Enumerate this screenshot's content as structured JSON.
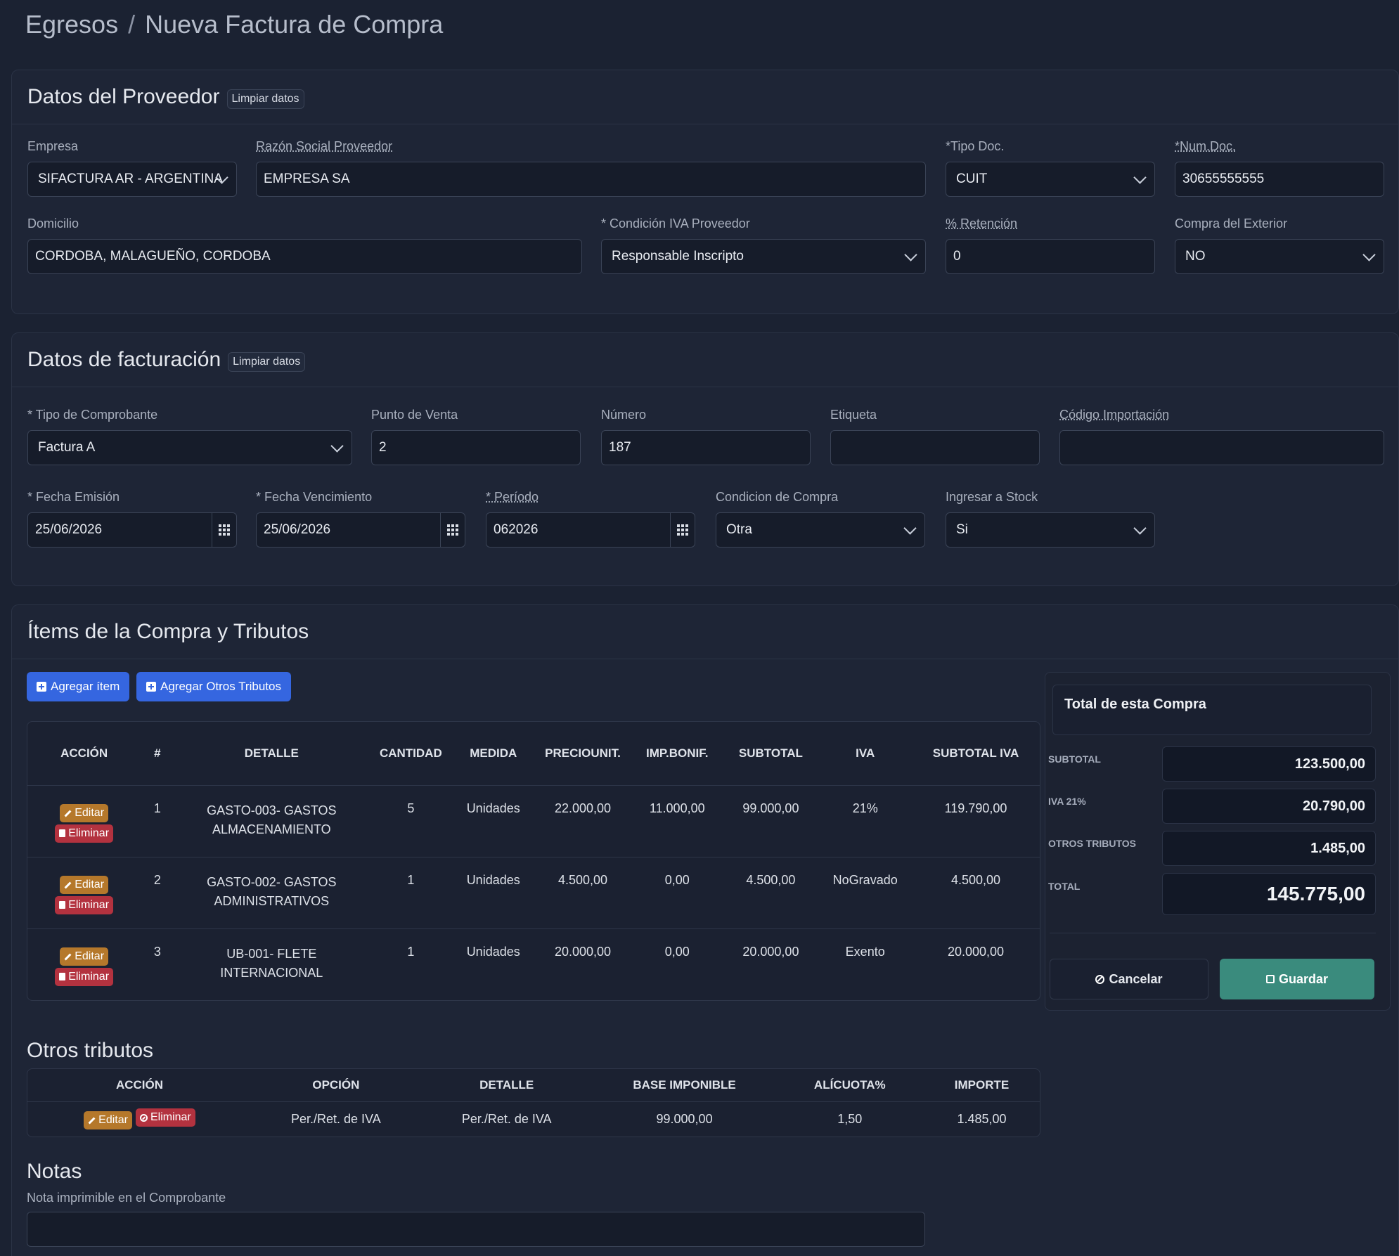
{
  "breadcrumb": {
    "parent": "Egresos",
    "separator": "/",
    "current": "Nueva Factura de Compra"
  },
  "proveedor": {
    "title": "Datos del Proveedor",
    "clear_label": "Limpiar datos",
    "empresa": {
      "label": "Empresa",
      "value": "SIFACTURA AR - ARGENTINA"
    },
    "razon_social": {
      "label": "Razón Social Proveedor",
      "value": "EMPRESA SA"
    },
    "tipo_doc": {
      "label": "*Tipo Doc.",
      "value": "CUIT"
    },
    "num_doc": {
      "label": "*Num.Doc.",
      "value": "30655555555"
    },
    "domicilio": {
      "label": "Domicilio",
      "value": "CORDOBA, MALAGUEÑO, CORDOBA"
    },
    "condicion_iva": {
      "label": "* Condición IVA Proveedor",
      "value": "Responsable Inscripto"
    },
    "retencion": {
      "label": "% Retención",
      "value": "0"
    },
    "compra_exterior": {
      "label": "Compra del Exterior",
      "value": "NO"
    }
  },
  "facturacion": {
    "title": "Datos de facturación",
    "clear_label": "Limpiar datos",
    "tipo_comprobante": {
      "label": "* Tipo de Comprobante",
      "value": "Factura A"
    },
    "punto_venta": {
      "label": "Punto de Venta",
      "value": "2"
    },
    "numero": {
      "label": "Número",
      "value": "187"
    },
    "etiqueta": {
      "label": "Etiqueta",
      "value": ""
    },
    "codigo_importacion": {
      "label": "Código Importación",
      "value": ""
    },
    "fecha_emision": {
      "label": "* Fecha Emisión",
      "value": "25/06/2026"
    },
    "fecha_vencimiento": {
      "label": "* Fecha Vencimiento",
      "value": "25/06/2026"
    },
    "periodo": {
      "label": "* Período",
      "value": "062026"
    },
    "condicion_compra": {
      "label": "Condicion de Compra",
      "value": "Otra"
    },
    "ingresar_stock": {
      "label": "Ingresar a Stock",
      "value": "Si"
    }
  },
  "items": {
    "title": "Ítems de la Compra y Tributos",
    "add_item_label": "Agregar ítem",
    "add_tributo_label": "Agregar Otros Tributos",
    "edit_label": "Editar",
    "delete_label": "Eliminar",
    "columns": [
      "ACCIÓN",
      "#",
      "DETALLE",
      "CANTIDAD",
      "MEDIDA",
      "PRECIOUNIT.",
      "IMP.BONIF.",
      "SUBTOTAL",
      "IVA",
      "SUBTOTAL IVA"
    ],
    "rows": [
      {
        "num": "1",
        "detalle": "GASTO-003- GASTOS ALMACENAMIENTO",
        "cantidad": "5",
        "medida": "Unidades",
        "precio": "22.000,00",
        "bonif": "11.000,00",
        "subtotal": "99.000,00",
        "iva": "21%",
        "subtotal_iva": "119.790,00"
      },
      {
        "num": "2",
        "detalle": "GASTO-002- GASTOS ADMINISTRATIVOS",
        "cantidad": "1",
        "medida": "Unidades",
        "precio": "4.500,00",
        "bonif": "0,00",
        "subtotal": "4.500,00",
        "iva": "NoGravado",
        "subtotal_iva": "4.500,00"
      },
      {
        "num": "3",
        "detalle": "UB-001- FLETE INTERNACIONAL",
        "cantidad": "1",
        "medida": "Unidades",
        "precio": "20.000,00",
        "bonif": "0,00",
        "subtotal": "20.000,00",
        "iva": "Exento",
        "subtotal_iva": "20.000,00"
      }
    ]
  },
  "totales": {
    "title": "Total de esta Compra",
    "subtotal": {
      "label": "SUBTOTAL",
      "value": "123.500,00"
    },
    "iva": {
      "label": "IVA 21%",
      "value": "20.790,00"
    },
    "otros": {
      "label": "OTROS TRIBUTOS",
      "value": "1.485,00"
    },
    "total": {
      "label": "TOTAL",
      "value": "145.775,00"
    },
    "cancel_label": "Cancelar",
    "save_label": "Guardar"
  },
  "otros_tributos": {
    "title": "Otros tributos",
    "columns": [
      "ACCIÓN",
      "OPCIÓN",
      "DETALLE",
      "BASE IMPONIBLE",
      "ALÍCUOTA%",
      "IMPORTE"
    ],
    "edit_label": "Editar",
    "delete_label": "Eliminar",
    "rows": [
      {
        "opcion": "Per./Ret. de IVA",
        "detalle": "Per./Ret. de IVA",
        "base": "99.000,00",
        "alicuota": "1,50",
        "importe": "1.485,00"
      }
    ]
  },
  "notas": {
    "title": "Notas",
    "label": "Nota imprimible en el Comprobante",
    "value": ""
  }
}
